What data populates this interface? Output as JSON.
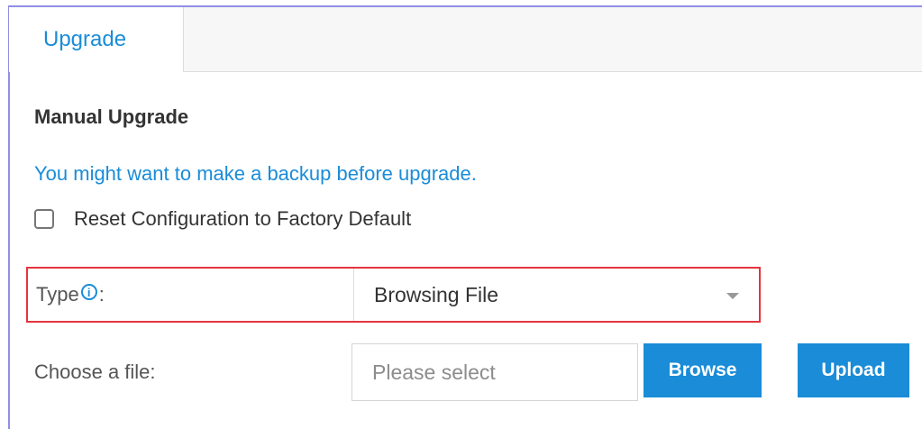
{
  "tabs": [
    {
      "label": "Upgrade",
      "active": true
    }
  ],
  "section": {
    "title": "Manual Upgrade",
    "backup_link": "You might want to make a backup before upgrade."
  },
  "reset_option": {
    "label": "Reset Configuration to Factory Default",
    "checked": false
  },
  "type_field": {
    "label": "Type",
    "colon": ":",
    "info_glyph": "i",
    "selected": "Browsing File"
  },
  "file_field": {
    "label": "Choose a file:",
    "placeholder": "Please select",
    "browse_label": "Browse",
    "upload_label": "Upload"
  },
  "colors": {
    "accent": "#1a8cd8",
    "highlight_border": "#e5343d"
  },
  "icons": {
    "info": "info-circle-icon",
    "dropdown": "chevron-down-icon"
  }
}
